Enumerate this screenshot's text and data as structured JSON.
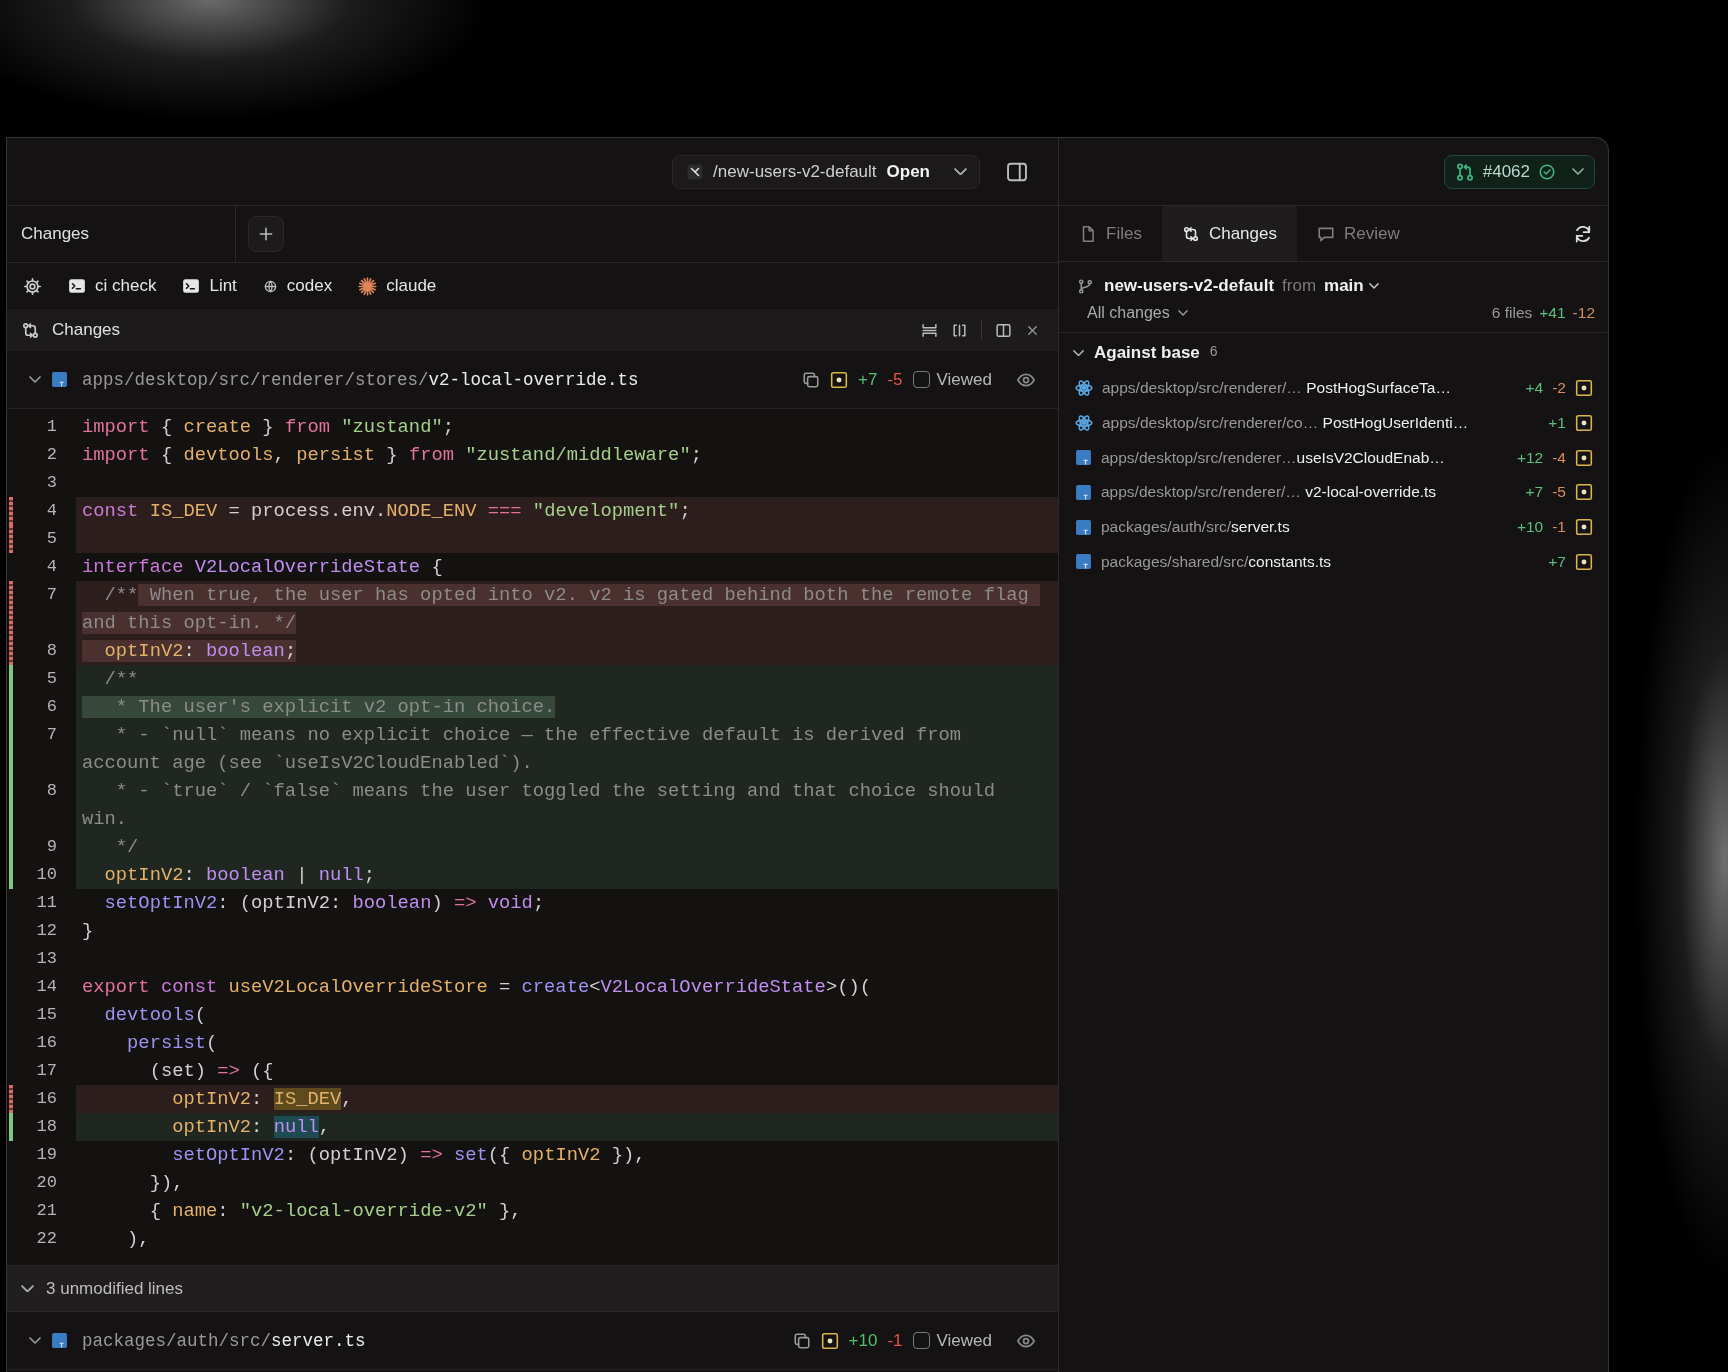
{
  "left_pane": {
    "header": {
      "branch": "/new-users-v2-default",
      "action": "Open"
    },
    "tab": {
      "label": "Changes"
    },
    "toolbar": [
      {
        "kind": "settings"
      },
      {
        "kind": "terminal",
        "label": "ci check"
      },
      {
        "kind": "terminal",
        "label": "Lint"
      },
      {
        "kind": "codex",
        "label": "codex"
      },
      {
        "kind": "claude",
        "label": "claude"
      }
    ],
    "changes_panel": {
      "title": "Changes"
    },
    "files": [
      {
        "kind": "ts",
        "path": "apps/desktop/src/renderer/stores/**v2-local-override.ts**",
        "expanded": true,
        "added": "+7",
        "removed": "-5",
        "viewed": false,
        "viewed_label": "Viewed",
        "lines": [
          {
            "num": "1",
            "kind": "context",
            "tokens": [
              {
                "kind": "kw",
                "text": "import"
              },
              {
                "kind": "p",
                "text": " { "
              },
              {
                "kind": "id",
                "text": "create"
              },
              {
                "kind": "p",
                "text": " } "
              },
              {
                "kind": "kw",
                "text": "from"
              },
              {
                "kind": "str",
                "text": " \"zustand\""
              },
              {
                "kind": "p",
                "text": ";"
              }
            ]
          },
          {
            "num": "2",
            "kind": "context",
            "tokens": [
              {
                "kind": "kw",
                "text": "import"
              },
              {
                "kind": "p",
                "text": " { "
              },
              {
                "kind": "id",
                "text": "devtools"
              },
              {
                "kind": "p",
                "text": ", "
              },
              {
                "kind": "id",
                "text": "persist"
              },
              {
                "kind": "p",
                "text": " } "
              },
              {
                "kind": "kw",
                "text": "from"
              },
              {
                "kind": "str",
                "text": " \"zustand/middleware\""
              },
              {
                "kind": "p",
                "text": ";"
              }
            ]
          },
          {
            "num": "3",
            "kind": "context"
          },
          {
            "num": "4",
            "kind": "removed",
            "tokens": [
              {
                "kind": "decl",
                "text": "const"
              },
              {
                "kind": "id",
                "text": " IS_DEV"
              },
              {
                "kind": "p",
                "text": " = process.env."
              },
              {
                "kind": "id",
                "text": "NODE_ENV"
              },
              {
                "kind": "op",
                "text": " ==="
              },
              {
                "kind": "str",
                "text": " \"development\""
              },
              {
                "kind": "p",
                "text": ";"
              }
            ]
          },
          {
            "num": "5",
            "kind": "removed"
          },
          {
            "num": "4",
            "kind": "context",
            "tokens": [
              {
                "kind": "decl",
                "text": "interface"
              },
              {
                "kind": "type",
                "text": " V2LocalOverrideState"
              },
              {
                "kind": "p",
                "text": " {"
              }
            ]
          },
          {
            "num": "7",
            "kind": "removed",
            "tokens": [
              {
                "kind": "cm",
                "text": "  /**"
              },
              {
                "kind": "cm",
                "text": " When true, the user has opted into v2. v2 is gated behind both the remote flag and this opt-in. */",
                "highlight": true
              }
            ]
          },
          {
            "num": "8",
            "kind": "removed",
            "tokens": [
              {
                "kind": "id",
                "text": "  optInV2",
                "highlight": true
              },
              {
                "kind": "p",
                "text": ": ",
                "highlight": true
              },
              {
                "kind": "type",
                "text": "boolean",
                "highlight": true
              },
              {
                "kind": "p",
                "text": ";",
                "highlight": true
              }
            ]
          },
          {
            "num": "5",
            "kind": "added",
            "tokens": [
              {
                "kind": "cm",
                "text": "  /**"
              }
            ]
          },
          {
            "num": "6",
            "kind": "added",
            "tokens": [
              {
                "kind": "cm",
                "text": "   * The user's explicit v2 opt-in choice.",
                "highlight": true
              }
            ]
          },
          {
            "num": "7",
            "kind": "added",
            "tokens": [
              {
                "kind": "cm",
                "text": "   * - `null` means no explicit choice — the effective default is derived from account age (see `useIsV2CloudEnabled`)."
              }
            ]
          },
          {
            "num": "8",
            "kind": "added",
            "tokens": [
              {
                "kind": "cm",
                "text": "   * - `true` / `false` means the user toggled the setting and that choice should win."
              }
            ]
          },
          {
            "num": "9",
            "kind": "added",
            "tokens": [
              {
                "kind": "cm",
                "text": "   */"
              }
            ]
          },
          {
            "num": "10",
            "kind": "added",
            "tokens": [
              {
                "kind": "id",
                "text": "  optInV2"
              },
              {
                "kind": "p",
                "text": ": "
              },
              {
                "kind": "type",
                "text": "boolean"
              },
              {
                "kind": "p",
                "text": " | "
              },
              {
                "kind": "type",
                "text": "null"
              },
              {
                "kind": "p",
                "text": ";"
              }
            ]
          },
          {
            "num": "11",
            "kind": "context",
            "tokens": [
              {
                "kind": "fn",
                "text": "  setOptInV2"
              },
              {
                "kind": "p",
                "text": ": (optInV2: "
              },
              {
                "kind": "type",
                "text": "boolean"
              },
              {
                "kind": "p",
                "text": ") "
              },
              {
                "kind": "op",
                "text": "=>"
              },
              {
                "kind": "type",
                "text": " void"
              },
              {
                "kind": "p",
                "text": ";"
              }
            ]
          },
          {
            "num": "12",
            "kind": "context",
            "tokens": [
              {
                "kind": "p",
                "text": "}"
              }
            ]
          },
          {
            "num": "13",
            "kind": "context"
          },
          {
            "num": "14",
            "kind": "context",
            "tokens": [
              {
                "kind": "kw",
                "text": "export"
              },
              {
                "kind": "decl",
                "text": " const"
              },
              {
                "kind": "id",
                "text": " useV2LocalOverrideStore"
              },
              {
                "kind": "p",
                "text": " = "
              },
              {
                "kind": "fn",
                "text": "create"
              },
              {
                "kind": "p",
                "text": "<"
              },
              {
                "kind": "type",
                "text": "V2LocalOverrideState"
              },
              {
                "kind": "p",
                "text": ">()("
              }
            ]
          },
          {
            "num": "15",
            "kind": "context",
            "tokens": [
              {
                "kind": "fn",
                "text": "  devtools"
              },
              {
                "kind": "p",
                "text": "("
              }
            ]
          },
          {
            "num": "16",
            "kind": "context",
            "tokens": [
              {
                "kind": "fn",
                "text": "    persist"
              },
              {
                "kind": "p",
                "text": "("
              }
            ]
          },
          {
            "num": "17",
            "kind": "context",
            "tokens": [
              {
                "kind": "p",
                "text": "      (set) "
              },
              {
                "kind": "op",
                "text": "=>"
              },
              {
                "kind": "p",
                "text": " ({"
              }
            ]
          },
          {
            "num": "16",
            "kind": "removed",
            "tokens": [
              {
                "kind": "id",
                "text": "        optInV2"
              },
              {
                "kind": "p",
                "text": ": "
              },
              {
                "kind": "id",
                "text": "IS_DEV",
                "highlight": true
              },
              {
                "kind": "p",
                "text": ","
              }
            ]
          },
          {
            "num": "18",
            "kind": "added",
            "tokens": [
              {
                "kind": "id",
                "text": "        optInV2"
              },
              {
                "kind": "p",
                "text": ": "
              },
              {
                "kind": "type",
                "text": "null",
                "highlight": true
              },
              {
                "kind": "p",
                "text": ","
              }
            ]
          },
          {
            "num": "19",
            "kind": "context",
            "tokens": [
              {
                "kind": "fn",
                "text": "        setOptInV2"
              },
              {
                "kind": "p",
                "text": ": (optInV2) "
              },
              {
                "kind": "op",
                "text": "=>"
              },
              {
                "kind": "fn",
                "text": " set"
              },
              {
                "kind": "p",
                "text": "({ "
              },
              {
                "kind": "id",
                "text": "optInV2"
              },
              {
                "kind": "p",
                "text": " }),"
              }
            ]
          },
          {
            "num": "20",
            "kind": "context",
            "tokens": [
              {
                "kind": "p",
                "text": "      }),"
              }
            ]
          },
          {
            "num": "21",
            "kind": "context",
            "tokens": [
              {
                "kind": "p",
                "text": "      { "
              },
              {
                "kind": "id",
                "text": "name"
              },
              {
                "kind": "p",
                "text": ": "
              },
              {
                "kind": "str",
                "text": "\"v2-local-override-v2\""
              },
              {
                "kind": "p",
                "text": " },"
              }
            ]
          },
          {
            "num": "22",
            "kind": "context",
            "tokens": [
              {
                "kind": "p",
                "text": "    ),"
              }
            ]
          }
        ],
        "collapsed_note": "3 unmodified lines"
      },
      {
        "kind": "ts",
        "path": "packages/auth/src/**server.ts**",
        "expanded": true,
        "added": "+10",
        "removed": "-1",
        "viewed": false,
        "viewed_label": "Viewed"
      }
    ]
  },
  "right_pane": {
    "pr": {
      "number": "#4062"
    },
    "tabs": [
      {
        "kind": "files",
        "label": "Files",
        "selected": false
      },
      {
        "kind": "changes",
        "label": "Changes",
        "selected": true
      },
      {
        "kind": "review",
        "label": "Review",
        "selected": false
      }
    ],
    "branch": {
      "name": "new-users-v2-default",
      "from": "from",
      "base": "main"
    },
    "filter": "All changes",
    "summary": {
      "files": "6 files",
      "added": "+41",
      "removed": "-12"
    },
    "group": {
      "title": "Against base",
      "count": "6",
      "expanded": true,
      "files": [
        {
          "kind": "react",
          "path": "apps/desktop/src/renderer/… **PostHogSurfaceTa…**",
          "added": "+4",
          "removed": "-2"
        },
        {
          "kind": "react",
          "path": "apps/desktop/src/renderer/co… **PostHogUserIdenti…**",
          "added": "+1"
        },
        {
          "kind": "ts",
          "path": "apps/desktop/src/renderer…**useIsV2CloudEnab…**",
          "added": "+12",
          "removed": "-4"
        },
        {
          "kind": "ts",
          "path": "apps/desktop/src/renderer/… **v2-local-override.ts**",
          "added": "+7",
          "removed": "-5"
        },
        {
          "kind": "ts",
          "path": "packages/auth/src/**server.ts**",
          "added": "+10",
          "removed": "-1"
        },
        {
          "kind": "ts",
          "path": "packages/shared/src/**constants.ts**",
          "added": "+7"
        }
      ]
    }
  }
}
